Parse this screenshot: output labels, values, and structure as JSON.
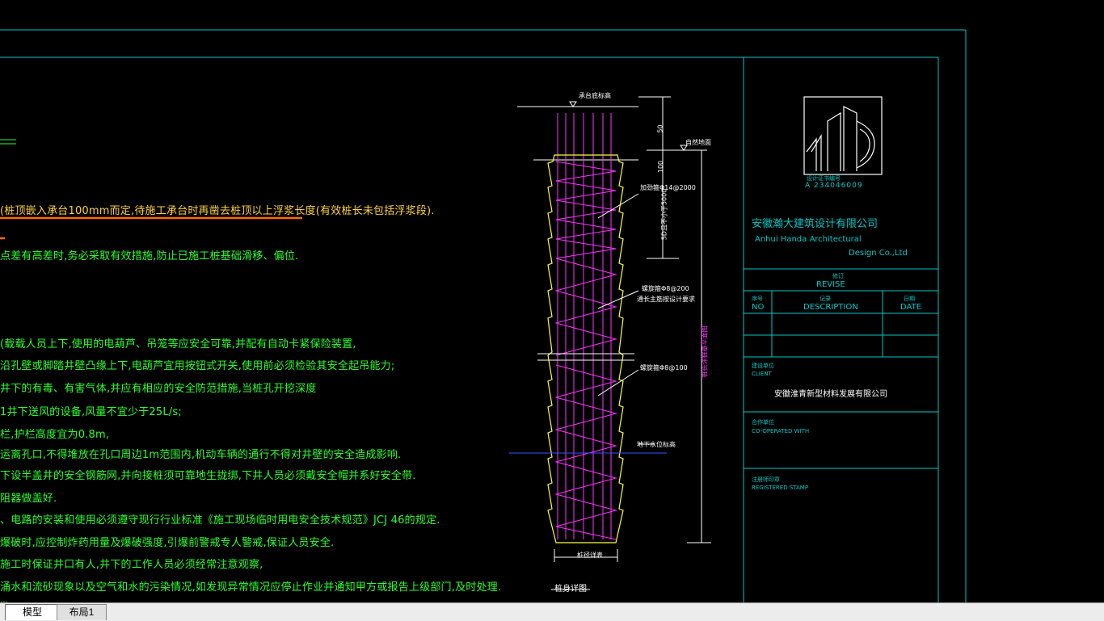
{
  "notes": [
    "(桩顶嵌入承台100mm而定,待施工承台时再凿去桩顶以上浮浆长度(有效桩长未包括浮浆段).",
    "点差有高差时,务必采取有效措施,防止已施工桩基础滑移、偏位.",
    "(载载人员上下,使用的电葫芦、吊笼等应安全可靠,并配有自动卡紧保险装置,",
    "沿孔壁或脚踏井壁凸缘上下,电葫芦宜用按钮式开关,使用前必须检验其安全起吊能力;",
    "井下的有毒、有害气体,并应有相应的安全防范措施,当桩孔开挖深度",
    "1井下送风的设备,风量不宜少于25L/s;",
    "栏,护栏高度宜为0.8m,",
    "运离孔口,不得堆放在孔口周边1m范围内,机动车辆的通行不得对井壁的安全造成影响.",
    "下设半盖井的安全钢筋网,并向接桩须可靠地生拢绑,下井人员必须戴安全帽并系好安全带.",
    "阻器做盖好.",
    "、电路的安装和使用必须遵守现行行业标准《施工现场临时用电安全技术规范》JCJ 46的规定.",
    "爆破时,应控制炸药用量及爆破强度,引爆前警戒专人警戒,保证人员安全.",
    "施工时保证井口有人,井下的工作人员必须经常注意观察,",
    "涌水和流砂现象以及空气和水的污染情况,如发现异常情况应停止作业并通知甲方或报告上级部门,及时处理.",
    "..."
  ],
  "pile": {
    "top_label": "承台底标高",
    "ground_label": "自然地面",
    "rebar_label_1": "加劲箍Φ14@2000",
    "rebar_label_2": "螺旋箍Φ8@200",
    "rebar_label_3": "通长主筋按设计要求",
    "rebar_label_4": "螺旋箍Φ8@100",
    "water_label": "地下水位标高",
    "dim_50": "50",
    "dim_100": "100",
    "dim_5d": "5D且不小于5000",
    "dim_length": "桩长详桩基平面图",
    "dim_width": "桩径详表",
    "caption": "桩身详图"
  },
  "title_block": {
    "logo_caption": "设计证书编号",
    "logo_number": "A 234046009",
    "company_cn": "安徽瀚大建筑设计有限公司",
    "company_en_1": "Anhui   Handa   Architectural",
    "company_en_2": "Design    Co.,Ltd",
    "revise_cn": "修订",
    "revise_en": "REVISE",
    "no_cn": "序号",
    "no_en": "NO",
    "desc_cn": "记录",
    "desc_en": "DESCRIPTION",
    "date_cn": "日期",
    "date_en": "DATE",
    "client_cn": "建设单位",
    "client_en": "CLIENT",
    "client_name": "安徽淮青新型材料发展有限公司",
    "coop_cn": "合作单位",
    "coop_en": "CO-OPERATED WITH",
    "stamp_cn": "注册师印章",
    "stamp_en": "REGISTERED STAMP"
  },
  "tabs": {
    "model": "模型",
    "layout1": "布局1"
  },
  "colors": {
    "frame": "#00c8c8",
    "text_green": "#2bff2b",
    "rebar": "#ff33ff",
    "pile_outline": "#ffff33",
    "highlight_underline": "#ff6a00"
  }
}
